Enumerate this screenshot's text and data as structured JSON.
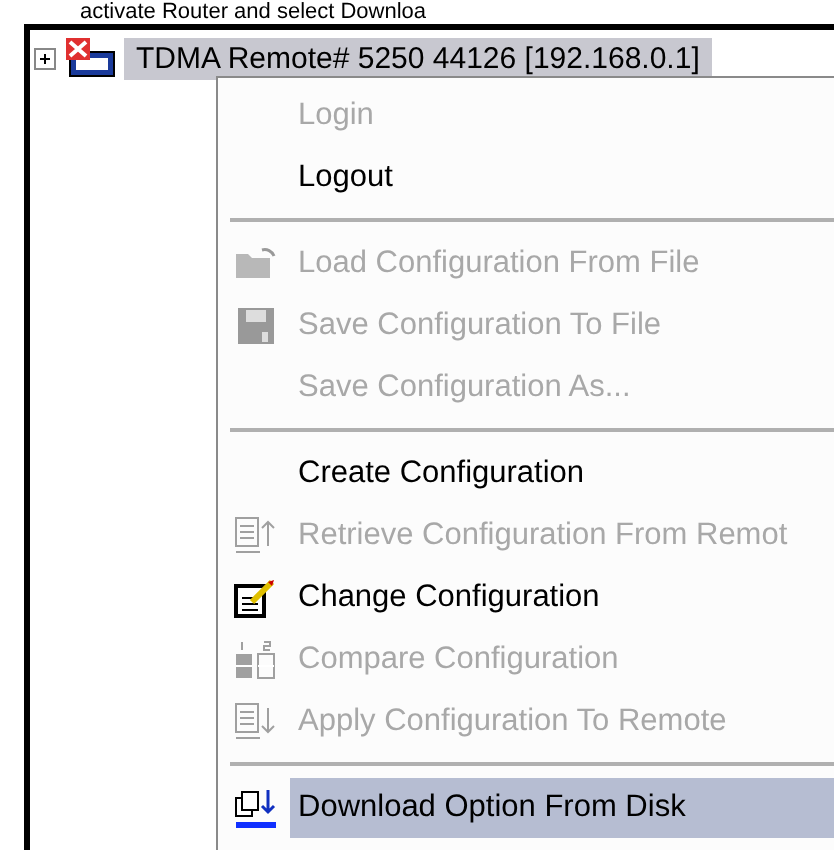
{
  "caption": "activate Router and select Downloa",
  "tree": {
    "node": {
      "label": "TDMA Remote# 5250 44126 [192.168.0.1]",
      "expanded": false,
      "selected": true
    }
  },
  "context_menu": {
    "items": [
      {
        "kind": "plain",
        "label": "Login",
        "disabled": true,
        "selected": false
      },
      {
        "kind": "plain",
        "label": "Logout",
        "disabled": false,
        "selected": false
      },
      {
        "kind": "separator"
      },
      {
        "kind": "folder",
        "label": "Load Configuration From File",
        "disabled": true,
        "selected": false
      },
      {
        "kind": "floppy",
        "label": "Save Configuration To File",
        "disabled": true,
        "selected": false
      },
      {
        "kind": "plain",
        "label": "Save Configuration As...",
        "disabled": true,
        "selected": false
      },
      {
        "kind": "separator"
      },
      {
        "kind": "plain",
        "label": "Create Configuration",
        "disabled": false,
        "selected": false
      },
      {
        "kind": "retrieve",
        "label": "Retrieve Configuration From Remot",
        "disabled": true,
        "selected": false
      },
      {
        "kind": "edit",
        "label": "Change Configuration",
        "disabled": false,
        "selected": false
      },
      {
        "kind": "compare",
        "label": "Compare Configuration",
        "disabled": true,
        "selected": false
      },
      {
        "kind": "apply",
        "label": "Apply Configuration To Remote",
        "disabled": true,
        "selected": false
      },
      {
        "kind": "separator"
      },
      {
        "kind": "download",
        "label": "Download Option From Disk",
        "disabled": false,
        "selected": true
      }
    ]
  }
}
